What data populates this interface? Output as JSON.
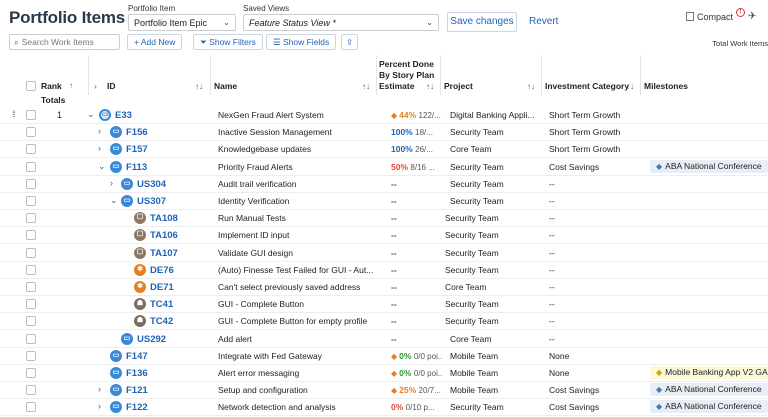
{
  "header": {
    "title": "Portfolio Items",
    "portfolio_item_label": "Portfolio Item",
    "portfolio_item_value": "Portfolio Item Epic",
    "saved_views_label": "Saved Views",
    "saved_views_value": "Feature Status View *",
    "save_changes": "Save changes",
    "revert": "Revert",
    "compact": "Compact",
    "compact_badge": "!"
  },
  "toolbar": {
    "search_placeholder": "Search Work Items",
    "add_new": "+ Add New",
    "show_filters": "Show Filters",
    "show_fields": "Show Fields",
    "total_label": "Total Work Items"
  },
  "columns": {
    "rank": "Rank",
    "id": "ID",
    "name": "Name",
    "percent_line1": "Percent Done",
    "percent_line2": "By Story Plan",
    "percent_line3": "Estimate",
    "project": "Project",
    "investment": "Investment Category",
    "milestones": "Milestones",
    "totals": "Totals"
  },
  "rows": [
    {
      "rank": "1",
      "indent": 0,
      "expand": "v",
      "icon": "epic",
      "id": "E33",
      "name": "NexGen Fraud Alert System",
      "pct": "44%",
      "pct_rest": "122/...",
      "pct_color": "#e67e22",
      "warn": true,
      "project": "Digital Banking Appli...",
      "invest": "Short Term Growth",
      "milestone": "",
      "ms_color": ""
    },
    {
      "rank": "",
      "indent": 1,
      "expand": ">",
      "icon": "feat",
      "id": "F156",
      "name": "Inactive Session Management",
      "pct": "100%",
      "pct_rest": "18/...",
      "pct_color": "#1f63b8",
      "warn": false,
      "project": "Security Team",
      "invest": "Short Term Growth",
      "milestone": "",
      "ms_color": ""
    },
    {
      "rank": "",
      "indent": 1,
      "expand": ">",
      "icon": "feat",
      "id": "F157",
      "name": "Knowledgebase updates",
      "pct": "100%",
      "pct_rest": "26/...",
      "pct_color": "#1f63b8",
      "warn": false,
      "project": "Core Team",
      "invest": "Short Term Growth",
      "milestone": "",
      "ms_color": ""
    },
    {
      "rank": "",
      "indent": 1,
      "expand": "v",
      "icon": "feat",
      "id": "F113",
      "name": "Priority Fraud Alerts",
      "pct": "50%",
      "pct_rest": "8/16 ...",
      "pct_color": "#e0483a",
      "warn": false,
      "project": "Security Team",
      "invest": "Cost Savings",
      "milestone": "ABA National Conference",
      "ms_color": "blue"
    },
    {
      "rank": "",
      "indent": 2,
      "expand": ">",
      "icon": "story",
      "id": "US304",
      "name": "Audit trail verification",
      "pct": "--",
      "pct_rest": "",
      "pct_color": "#444",
      "warn": false,
      "project": "Security Team",
      "invest": "--",
      "milestone": "",
      "ms_color": ""
    },
    {
      "rank": "",
      "indent": 2,
      "expand": "v",
      "icon": "story",
      "id": "US307",
      "name": "Identity Verification",
      "pct": "--",
      "pct_rest": "",
      "pct_color": "#444",
      "warn": false,
      "project": "Security Team",
      "invest": "--",
      "milestone": "",
      "ms_color": ""
    },
    {
      "rank": "",
      "indent": 3,
      "expand": "",
      "icon": "task",
      "id": "TA108",
      "name": "Run Manual Tests",
      "pct": "--",
      "pct_rest": "",
      "pct_color": "#444",
      "warn": false,
      "project": "Security Team",
      "invest": "--",
      "milestone": "",
      "ms_color": ""
    },
    {
      "rank": "",
      "indent": 3,
      "expand": "",
      "icon": "task",
      "id": "TA106",
      "name": "Implement ID input",
      "pct": "--",
      "pct_rest": "",
      "pct_color": "#444",
      "warn": false,
      "project": "Security Team",
      "invest": "--",
      "milestone": "",
      "ms_color": ""
    },
    {
      "rank": "",
      "indent": 3,
      "expand": "",
      "icon": "task",
      "id": "TA107",
      "name": "Validate GUI design",
      "pct": "--",
      "pct_rest": "",
      "pct_color": "#444",
      "warn": false,
      "project": "Security Team",
      "invest": "--",
      "milestone": "",
      "ms_color": ""
    },
    {
      "rank": "",
      "indent": 3,
      "expand": "",
      "icon": "defect",
      "id": "DE76",
      "name": "(Auto) Finesse Test Failed for GUI - Aut...",
      "pct": "--",
      "pct_rest": "",
      "pct_color": "#444",
      "warn": false,
      "project": "Security Team",
      "invest": "--",
      "milestone": "",
      "ms_color": ""
    },
    {
      "rank": "",
      "indent": 3,
      "expand": "",
      "icon": "defect",
      "id": "DE71",
      "name": "Can't select previously saved address",
      "pct": "--",
      "pct_rest": "",
      "pct_color": "#444",
      "warn": false,
      "project": "Core Team",
      "invest": "--",
      "milestone": "",
      "ms_color": ""
    },
    {
      "rank": "",
      "indent": 3,
      "expand": "",
      "icon": "test",
      "id": "TC41",
      "name": "GUI - Complete Button",
      "pct": "--",
      "pct_rest": "",
      "pct_color": "#444",
      "warn": false,
      "project": "Security Team",
      "invest": "--",
      "milestone": "",
      "ms_color": ""
    },
    {
      "rank": "",
      "indent": 3,
      "expand": "",
      "icon": "test",
      "id": "TC42",
      "name": "GUI - Complete Button for empty profile",
      "pct": "--",
      "pct_rest": "",
      "pct_color": "#444",
      "warn": false,
      "project": "Security Team",
      "invest": "--",
      "milestone": "",
      "ms_color": ""
    },
    {
      "rank": "",
      "indent": 2,
      "expand": "",
      "icon": "story",
      "id": "US292",
      "name": "Add alert",
      "pct": "--",
      "pct_rest": "",
      "pct_color": "#444",
      "warn": false,
      "project": "Core Team",
      "invest": "--",
      "milestone": "",
      "ms_color": ""
    },
    {
      "rank": "",
      "indent": 1,
      "expand": "",
      "icon": "feat",
      "id": "F147",
      "name": "Integrate with Fed Gateway",
      "pct": "0%",
      "pct_rest": "0/0 poi...",
      "pct_color": "#2e9b3a",
      "warn": true,
      "project": "Mobile Team",
      "invest": "None",
      "milestone": "",
      "ms_color": ""
    },
    {
      "rank": "",
      "indent": 1,
      "expand": "",
      "icon": "feat",
      "id": "F136",
      "name": "Alert error messaging",
      "pct": "0%",
      "pct_rest": "0/0 poi...",
      "pct_color": "#2e9b3a",
      "warn": true,
      "project": "Mobile Team",
      "invest": "None",
      "milestone": "Mobile Banking App V2 GA",
      "ms_color": "yellow"
    },
    {
      "rank": "",
      "indent": 1,
      "expand": ">",
      "icon": "feat",
      "id": "F121",
      "name": "Setup and configuration",
      "pct": "25%",
      "pct_rest": "20/7...",
      "pct_color": "#e67e22",
      "warn": true,
      "project": "Mobile Team",
      "invest": "Cost Savings",
      "milestone": "ABA National Conference",
      "ms_color": "blue"
    },
    {
      "rank": "",
      "indent": 1,
      "expand": ">",
      "icon": "feat",
      "id": "F122",
      "name": "Network detection and analysis",
      "pct": "0%",
      "pct_rest": "0/10 p...",
      "pct_color": "#e0483a",
      "warn": false,
      "project": "Security Team",
      "invest": "Cost Savings",
      "milestone": "ABA National Conference",
      "ms_color": "blue"
    }
  ]
}
